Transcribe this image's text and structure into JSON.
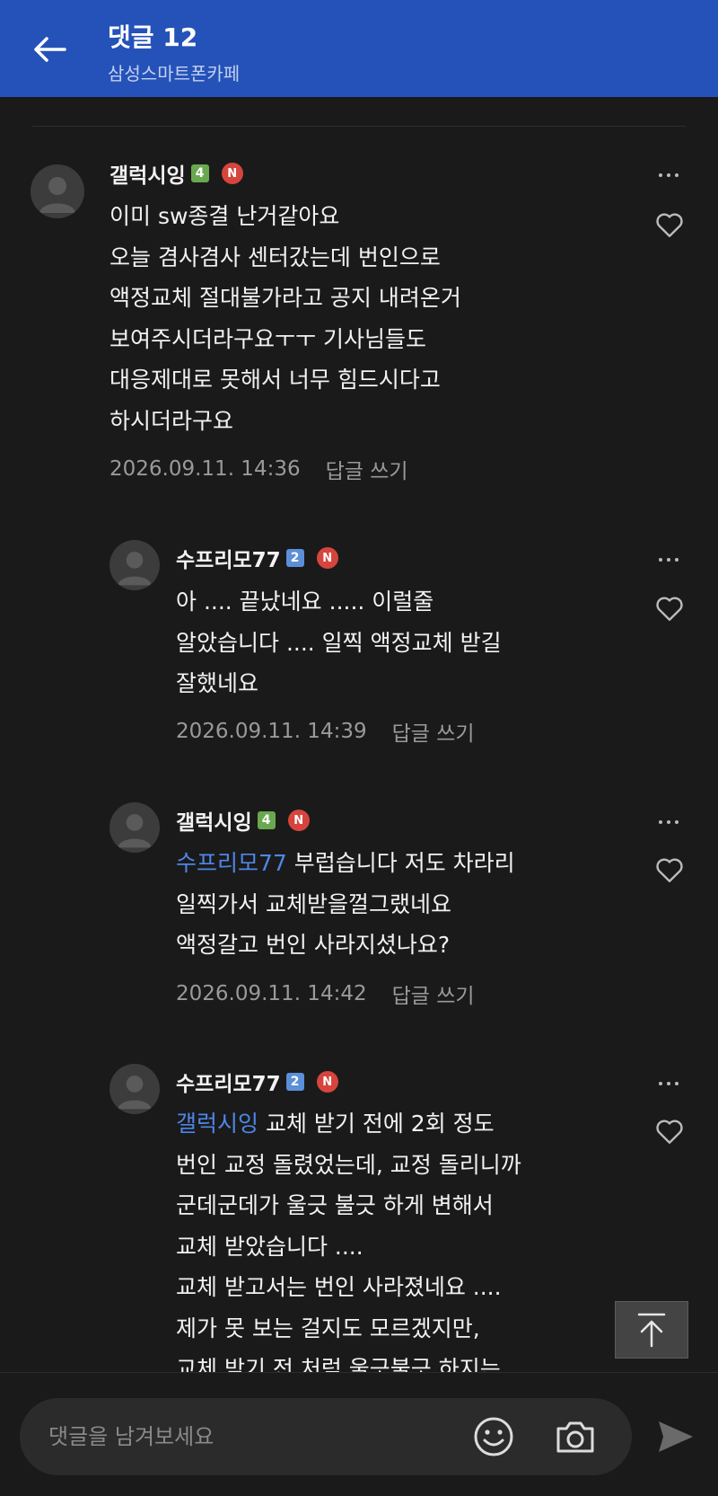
{
  "header": {
    "title": "댓글 12",
    "subtitle": "삼성스마트폰카페"
  },
  "colors": {
    "header_bg": "#2552b8",
    "background": "#1a1a1a",
    "mention": "#4f86e8",
    "new_badge": "#d6453d"
  },
  "comments": [
    {
      "nickname": "갤럭시잉",
      "level": "4",
      "badge": "N",
      "text": "이미 sw종결 난거같아요\n오늘 겸사겸사 센터갔는데 번인으로\n액정교체 절대불가라고 공지 내려온거\n보여주시더라구요ㅜㅜ 기사님들도\n대응제대로 못해서 너무 힘드시다고\n하시더라구요",
      "timestamp": "2026.09.11. 14:36",
      "reply_label": "답글 쓰기"
    },
    {
      "nickname": "수프리모77",
      "level": "2",
      "badge": "N",
      "text": "아 .... 끝났네요 ..... 이럴줄\n알았습니다 .... 일찍 액정교체 받길\n잘했네요",
      "timestamp": "2026.09.11. 14:39",
      "reply_label": "답글 쓰기"
    },
    {
      "nickname": "갤럭시잉",
      "level": "4",
      "badge": "N",
      "mention": "수프리모77",
      "text": " 부럽습니다 저도 차라리\n일찍가서 교체받을껄그랬네요\n액정갈고 번인 사라지셨나요?",
      "timestamp": "2026.09.11. 14:42",
      "reply_label": "답글 쓰기"
    },
    {
      "nickname": "수프리모77",
      "level": "2",
      "badge": "N",
      "mention": "갤럭시잉",
      "text": " 교체 받기 전에 2회 정도\n번인 교정 돌렸었는데, 교정 돌리니까\n군데군데가 울긋 불긋 하게 변해서\n교체 받았습니다 ....\n교체 받고서는 번인 사라졌네요 ....\n제가 못 보는 걸지도 모르겠지만,\n교체 받기 전 처럼 울긋불긋 하지는"
    }
  ],
  "composer": {
    "placeholder": "댓글을 남겨보세요"
  },
  "icons": {
    "back": "arrow-left-icon",
    "more": "more-dots-icon",
    "like": "heart-outline-icon",
    "scroll_top": "arrow-up-to-top-icon",
    "emoji": "smiley-icon",
    "camera": "camera-icon",
    "send": "send-icon"
  }
}
